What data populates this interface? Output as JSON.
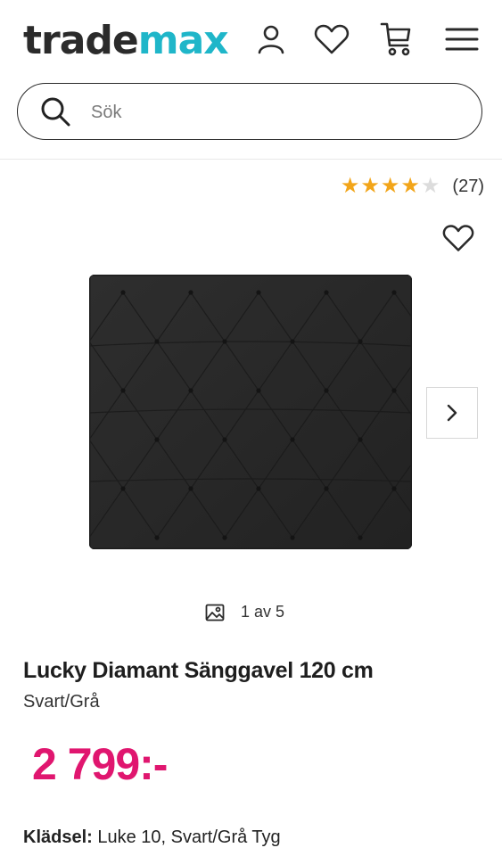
{
  "brand": {
    "name_part1": "trade",
    "name_part2": "max",
    "accent": "#1fb6c9"
  },
  "header_icons": [
    "user-icon",
    "heart-icon",
    "cart-icon",
    "menu-icon"
  ],
  "search": {
    "placeholder": "Sök"
  },
  "rating": {
    "value": 4,
    "max": 5,
    "count": "(27)",
    "star_color": "#f2a51a"
  },
  "gallery": {
    "counter": "1 av 5"
  },
  "product": {
    "title": "Lucky Diamant Sänggavel 120 cm",
    "variant": "Svart/Grå",
    "price": "2 799:-",
    "price_color": "#e0166f",
    "spec_label": "Klädsel:",
    "spec_value": "Luke 10, Svart/Grå Tyg"
  }
}
